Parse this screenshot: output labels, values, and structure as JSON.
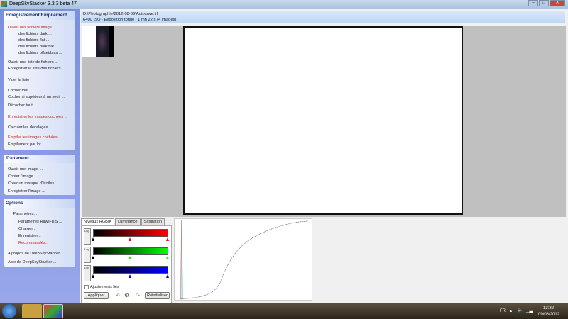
{
  "window": {
    "title": "DeepSkyStacker 3.3.3 beta 47",
    "min": "–",
    "max": "□",
    "close": "✕"
  },
  "panels": {
    "stacking": {
      "title": "Enregistrement/Empilement",
      "items": [
        {
          "label": "Ouvrir des fichiers image ...",
          "red": true,
          "indent": 0
        },
        {
          "label": "des fichiers dark ...",
          "indent": 1
        },
        {
          "label": "des fichiers flat ...",
          "indent": 1
        },
        {
          "label": "des fichiers dark flat ...",
          "indent": 1
        },
        {
          "label": "des fichiers offset/bias ...",
          "indent": 1
        },
        {
          "label": "Ouvrir une liste de fichiers ...",
          "indent": 0
        },
        {
          "label": "Enregistrer la liste des fichiers ...",
          "indent": 0
        },
        {
          "label": "Vider la liste",
          "indent": 0
        },
        {
          "label": "Cocher tout",
          "indent": 0
        },
        {
          "label": "Cocher si supérieur à un seuil ...",
          "indent": 0
        },
        {
          "label": "Décocher tout",
          "indent": 0
        },
        {
          "label": "Enregistrer les images cochées ...",
          "red": true,
          "indent": 0
        },
        {
          "label": "Calculer les décalages ...",
          "indent": 0
        },
        {
          "label": "Empiler les images cochées ...",
          "red": true,
          "indent": 0
        },
        {
          "label": "Empilement par lot ...",
          "indent": 0
        }
      ]
    },
    "processing": {
      "title": "Traitement",
      "items": [
        {
          "label": "Ouvrir une image ...",
          "indent": 0
        },
        {
          "label": "Copier l'image",
          "indent": 0
        },
        {
          "label": "Créer un masque d'étoiles ...",
          "indent": 0
        },
        {
          "label": "Enregistrer l'image ...",
          "indent": 0
        }
      ]
    },
    "options": {
      "title": "Options",
      "items": [
        {
          "label": "Paramètres...",
          "indent": 0.5
        },
        {
          "label": "Paramètres Raw/FITS ...",
          "indent": 1
        },
        {
          "label": "Charger...",
          "indent": 1
        },
        {
          "label": "Enregistrer...",
          "indent": 1
        },
        {
          "label": "Recommandés...",
          "red": true,
          "indent": 1
        },
        {
          "label": "A propos de DeepSkyStacker ...",
          "indent": 0
        },
        {
          "label": "Aide de DeepSkyStacker ...",
          "indent": 0
        }
      ]
    }
  },
  "info": {
    "path": "D:\\Photographie\\2012-08-09\\Autosave.tif",
    "details": "6400 ISO - Exposition totale : 1 mn 22 s (4 images)"
  },
  "adjust": {
    "tabs": [
      "Niveaux RGB/K",
      "Luminance",
      "Saturation"
    ],
    "active_tab": 0,
    "linked_label": "Ajustements liés",
    "linked": false,
    "apply": "Appliquer",
    "reset": "Réinitialiser",
    "log_label": "Log",
    "channels": [
      {
        "name": "red",
        "color": "#ff0000"
      },
      {
        "name": "green",
        "color": "#00ff00"
      },
      {
        "name": "blue",
        "color": "#0000ff"
      }
    ],
    "undo_icon": "undo-icon",
    "settings_icon": "gear-icon",
    "redo_icon": "redo-icon"
  },
  "taskbar": {
    "lang": "FR",
    "time": "13:32",
    "date": "09/08/2012"
  }
}
